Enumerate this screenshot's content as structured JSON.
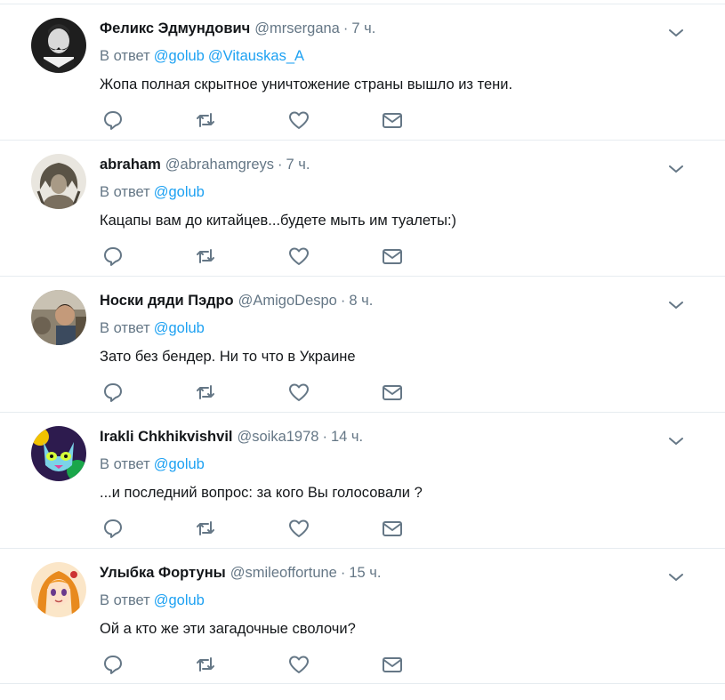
{
  "tweets": [
    {
      "fullname": "Феликс Эдмундович",
      "handle": "@mrsergana",
      "dot": "·",
      "time": "7 ч.",
      "reply_prefix": "В ответ",
      "mentions": [
        "@golub",
        "@Vitauskas_A"
      ],
      "text": "Жопа полная скрытное уничтожение страны вышло из тени.",
      "avatar": "avatar-man-mustache"
    },
    {
      "fullname": "abraham",
      "handle": "@abrahamgreys",
      "dot": "·",
      "time": "7 ч.",
      "reply_prefix": "В ответ",
      "mentions": [
        "@golub"
      ],
      "text": "Кацапы вам до китайцев...будете мыть им туалеты:)",
      "avatar": "avatar-headdress"
    },
    {
      "fullname": "Носки дяди Пэдро",
      "handle": "@AmigoDespo",
      "dot": "·",
      "time": "8 ч.",
      "reply_prefix": "В ответ",
      "mentions": [
        "@golub"
      ],
      "text": "Зато без бендер. Ни то что в Украине",
      "avatar": "avatar-photo-child"
    },
    {
      "fullname": "Irakli Chkhikvishvil",
      "handle": "@soika1978",
      "dot": "·",
      "time": "14 ч.",
      "reply_prefix": "В ответ",
      "mentions": [
        "@golub"
      ],
      "text": "...и последний вопрос: за кого Вы голосовали ?",
      "avatar": "avatar-neon-cat"
    },
    {
      "fullname": "Улыбка Фортуны",
      "handle": "@smileoffortune",
      "dot": "·",
      "time": "15 ч.",
      "reply_prefix": "В ответ",
      "mentions": [
        "@golub"
      ],
      "text": "Ой а кто же эти загадочные сволочи?",
      "avatar": "avatar-anime-girl"
    }
  ],
  "colors": {
    "name": "#14171a",
    "muted": "#657786",
    "link": "#1da1f2",
    "icon": "#657786",
    "divider": "#e6ecf0"
  },
  "icons": {
    "reply": "reply-icon",
    "retweet": "retweet-icon",
    "like": "heart-icon",
    "dm": "envelope-icon",
    "more": "chevron-down-icon"
  }
}
